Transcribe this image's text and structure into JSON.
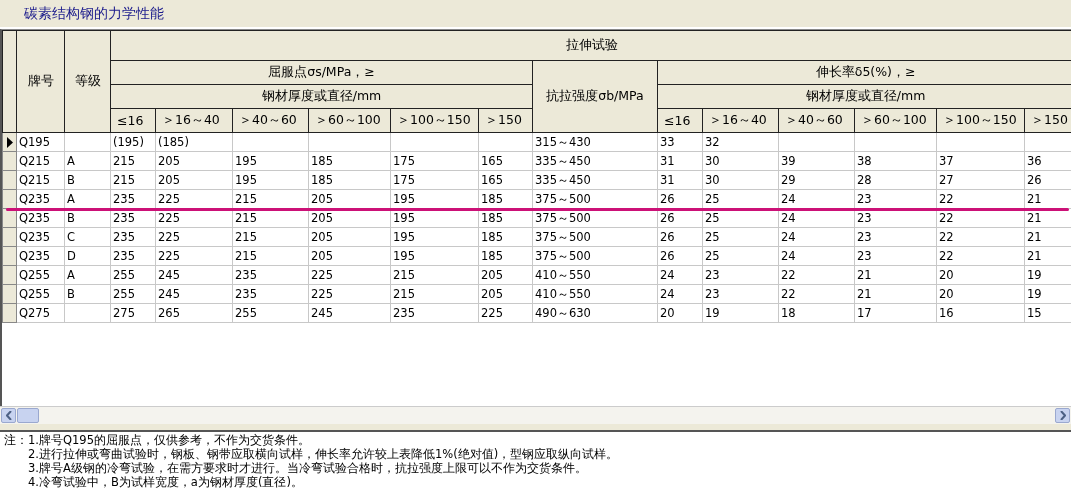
{
  "title": "碳素结构钢的力学性能",
  "header": {
    "brand": "牌号",
    "grade": "等级",
    "group": "拉伸试验",
    "yield": "屈服点σs/MPa，≥",
    "yield_size": "钢材厚度或直径/mm",
    "tensile": "抗拉强度σb/MPa",
    "elongation": "伸长率δ5(%)，≥",
    "elongation_size": "钢材厚度或直径/mm",
    "yield_ranges": [
      "≤16",
      "＞16～40",
      "＞40～60",
      "＞60～100",
      "＞100～150",
      "＞150"
    ],
    "elongation_ranges": [
      "≤16",
      "＞16～40",
      "＞40～60",
      "＞60～100",
      "＞100～150",
      "＞150"
    ]
  },
  "rows": [
    {
      "selected": true,
      "cells": [
        "Q195",
        null,
        "(195)",
        "(185)",
        null,
        null,
        null,
        null,
        "315～430",
        "33",
        "32",
        null,
        null,
        null,
        null
      ]
    },
    {
      "selected": false,
      "cells": [
        "Q215",
        "A",
        "215",
        "205",
        "195",
        "185",
        "175",
        "165",
        "335～450",
        "31",
        "30",
        "39",
        "38",
        "37",
        "36"
      ]
    },
    {
      "selected": false,
      "cells": [
        "Q215",
        "B",
        "215",
        "205",
        "195",
        "185",
        "175",
        "165",
        "335～450",
        "31",
        "30",
        "29",
        "28",
        "27",
        "26"
      ]
    },
    {
      "selected": false,
      "cells": [
        "Q235",
        "A",
        "235",
        "225",
        "215",
        "205",
        "195",
        "185",
        "375～500",
        "26",
        "25",
        "24",
        "23",
        "22",
        "21"
      ]
    },
    {
      "selected": false,
      "cells": [
        "Q235",
        "B",
        "235",
        "225",
        "215",
        "205",
        "195",
        "185",
        "375～500",
        "26",
        "25",
        "24",
        "23",
        "22",
        "21"
      ]
    },
    {
      "selected": false,
      "cells": [
        "Q235",
        "C",
        "235",
        "225",
        "215",
        "205",
        "195",
        "185",
        "375～500",
        "26",
        "25",
        "24",
        "23",
        "22",
        "21"
      ]
    },
    {
      "selected": false,
      "cells": [
        "Q235",
        "D",
        "235",
        "225",
        "215",
        "205",
        "195",
        "185",
        "375～500",
        "26",
        "25",
        "24",
        "23",
        "22",
        "21"
      ]
    },
    {
      "selected": false,
      "cells": [
        "Q255",
        "A",
        "255",
        "245",
        "235",
        "225",
        "215",
        "205",
        "410～550",
        "24",
        "23",
        "22",
        "21",
        "20",
        "19"
      ]
    },
    {
      "selected": false,
      "cells": [
        "Q255",
        "B",
        "255",
        "245",
        "235",
        "225",
        "215",
        "205",
        "410～550",
        "24",
        "23",
        "22",
        "21",
        "20",
        "19"
      ]
    },
    {
      "selected": false,
      "cells": [
        "Q275",
        null,
        "275",
        "265",
        "255",
        "245",
        "235",
        "225",
        "490～630",
        "20",
        "19",
        "18",
        "17",
        "16",
        "15"
      ]
    }
  ],
  "notes": {
    "label": "注：",
    "items": [
      "1.牌号Q195的屈服点，仅供参考，不作为交货条件。",
      "2.进行拉伸或弯曲试验时，钢板、钢带应取横向试样，伸长率允许较上表降低1%(绝对值)，型钢应取纵向试样。",
      "3.牌号A级钢的冷弯试验，在需方要求时才进行。当冷弯试验合格时，抗拉强度上限可以不作为交货条件。",
      "4.冷弯试验中，B为试样宽度，a为钢材厚度(直径)。"
    ]
  }
}
